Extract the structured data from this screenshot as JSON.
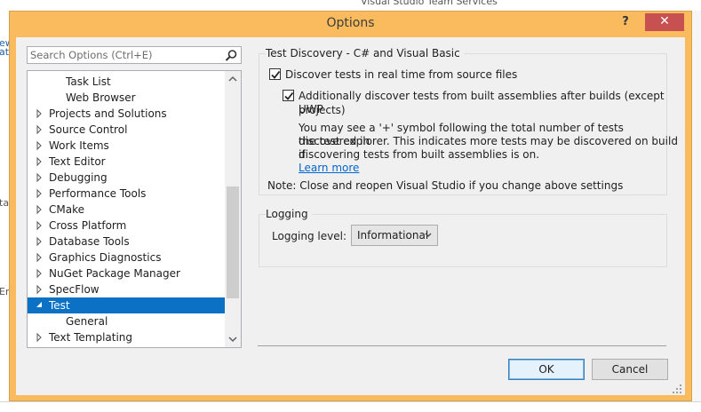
{
  "background": {
    "vsts_text": "Visual Studio Team Services",
    "left_fragments": [
      "ew",
      "ati",
      "ta",
      "Err"
    ]
  },
  "dialog": {
    "title": "Options",
    "help": "?",
    "close": "✕"
  },
  "search": {
    "placeholder": "Search Options (Ctrl+E)"
  },
  "tree": {
    "items": [
      {
        "label": "Task List",
        "indent": 1,
        "expandable": false,
        "expanded": false,
        "selected": false
      },
      {
        "label": "Web Browser",
        "indent": 1,
        "expandable": false,
        "expanded": false,
        "selected": false
      },
      {
        "label": "Projects and Solutions",
        "indent": 0,
        "expandable": true,
        "expanded": false,
        "selected": false
      },
      {
        "label": "Source Control",
        "indent": 0,
        "expandable": true,
        "expanded": false,
        "selected": false
      },
      {
        "label": "Work Items",
        "indent": 0,
        "expandable": true,
        "expanded": false,
        "selected": false
      },
      {
        "label": "Text Editor",
        "indent": 0,
        "expandable": true,
        "expanded": false,
        "selected": false
      },
      {
        "label": "Debugging",
        "indent": 0,
        "expandable": true,
        "expanded": false,
        "selected": false
      },
      {
        "label": "Performance Tools",
        "indent": 0,
        "expandable": true,
        "expanded": false,
        "selected": false
      },
      {
        "label": "CMake",
        "indent": 0,
        "expandable": true,
        "expanded": false,
        "selected": false
      },
      {
        "label": "Cross Platform",
        "indent": 0,
        "expandable": true,
        "expanded": false,
        "selected": false
      },
      {
        "label": "Database Tools",
        "indent": 0,
        "expandable": true,
        "expanded": false,
        "selected": false
      },
      {
        "label": "Graphics Diagnostics",
        "indent": 0,
        "expandable": true,
        "expanded": false,
        "selected": false
      },
      {
        "label": "NuGet Package Manager",
        "indent": 0,
        "expandable": true,
        "expanded": false,
        "selected": false
      },
      {
        "label": "SpecFlow",
        "indent": 0,
        "expandable": true,
        "expanded": false,
        "selected": false
      },
      {
        "label": "Test",
        "indent": 0,
        "expandable": true,
        "expanded": true,
        "selected": true
      },
      {
        "label": "General",
        "indent": 1,
        "expandable": false,
        "expanded": false,
        "selected": false
      },
      {
        "label": "Text Templating",
        "indent": 0,
        "expandable": true,
        "expanded": false,
        "selected": false
      }
    ]
  },
  "discovery": {
    "group_title": "Test Discovery - C# and Visual Basic",
    "realtime_label": "Discover tests in real time from source files",
    "realtime_checked": true,
    "assemblies_label_line1": "Additionally discover tests from built assemblies after builds (except UWP",
    "assemblies_label_line2": "projects)",
    "assemblies_checked": true,
    "info_line1": "You may see a '+' symbol following the total number of tests discovered in",
    "info_line2": "the test explorer. This indicates more tests may be discovered on build if",
    "info_line3": "discovering tests from built assemblies is on.",
    "learn_more": "Learn more",
    "note": "Note: Close and reopen Visual Studio if you change above settings"
  },
  "logging": {
    "group_title": "Logging",
    "level_label": "Logging level:",
    "level_value": "Informational"
  },
  "buttons": {
    "ok": "OK",
    "cancel": "Cancel"
  },
  "colors": {
    "title_bar": "#fabb5f",
    "close_button": "#c75050",
    "selection": "#0b71c4",
    "link": "#0066cc"
  }
}
